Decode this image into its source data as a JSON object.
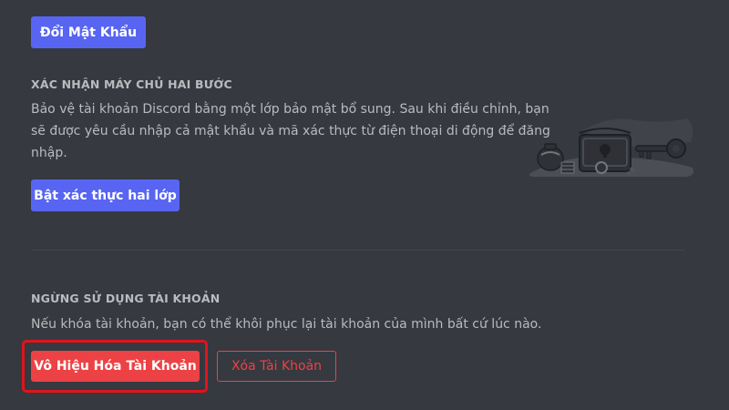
{
  "password": {
    "change_button_label": "Đổi Mật Khẩu"
  },
  "two_factor": {
    "title": "XÁC NHẬN MÁY CHỦ HAI BƯỚC",
    "description_line1": "Bảo vệ tài khoản Discord bằng một lớp bảo mật bổ sung. Sau khi điều chỉnh, bạn",
    "description_line2": "sẽ được yêu cầu nhập cả mật khẩu và mã xác thực từ điện thoại di động để đăng",
    "description_line3": "nhập.",
    "enable_button_label": "Bật xác thực hai lớp",
    "illustration_icon": "safe-with-key-illustration"
  },
  "account_removal": {
    "title": "NGỪNG SỬ DỤNG TÀI KHOẢN",
    "description": "Nếu khóa tài khoản, bạn có thể khôi phục lại tài khoản của mình bất cứ lúc nào.",
    "disable_button_label": "Vô Hiệu Hóa Tài Khoản",
    "delete_button_label": "Xóa Tài Khoản"
  },
  "colors": {
    "background": "#36393f",
    "brand": "#5865f2",
    "danger": "#ed4245",
    "highlight": "#e0141c",
    "text_muted": "#b9bbbe"
  }
}
